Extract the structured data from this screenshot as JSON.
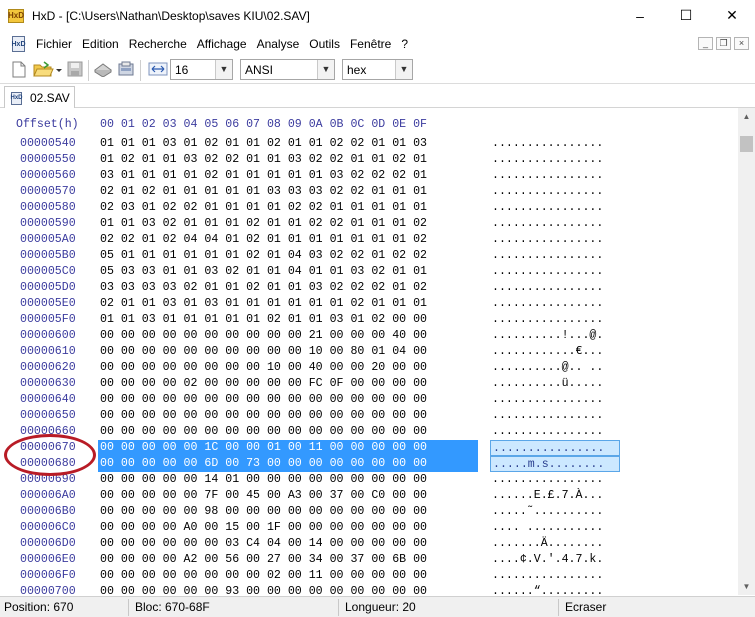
{
  "window": {
    "title": "HxD - [C:\\Users\\Nathan\\Desktop\\saves KIU\\02.SAV]",
    "icon": "hxd-app-icon",
    "minimize": "–",
    "maximize": "☐",
    "close": "✕"
  },
  "menu": {
    "items": [
      "Fichier",
      "Edition",
      "Recherche",
      "Affichage",
      "Analyse",
      "Outils",
      "Fenêtre",
      "?"
    ],
    "mdi_minimize": "_",
    "mdi_restore": "❐",
    "mdi_close": "×"
  },
  "toolbar": {
    "bytes_per_row": "16",
    "charset": "ANSI",
    "offset_base": "hex",
    "icons": [
      "new-file-icon",
      "open-folder-icon",
      "save-icon",
      "open-disk-icon",
      "open-ram-icon",
      "bytes-per-row-icon"
    ]
  },
  "tabs": [
    {
      "label": "02.SAV"
    }
  ],
  "editor": {
    "offset_header": "Offset(h)",
    "column_header": "00 01 02 03 04 05 06 07 08 09 0A 0B 0C 0D 0E 0F",
    "rows": [
      {
        "offset": "00000540",
        "hex": "01 01 01 03 01 02 01 01 02 01 01 02 02 01 01 03",
        "text": "................"
      },
      {
        "offset": "00000550",
        "hex": "01 02 01 01 03 02 02 01 01 03 02 02 01 01 02 01",
        "text": "................"
      },
      {
        "offset": "00000560",
        "hex": "03 01 01 01 01 02 01 01 01 01 01 03 02 02 02 01",
        "text": "................"
      },
      {
        "offset": "00000570",
        "hex": "02 01 02 01 01 01 01 01 03 03 03 02 02 01 01 01",
        "text": "................"
      },
      {
        "offset": "00000580",
        "hex": "02 03 01 02 02 01 01 01 01 02 02 01 01 01 01 01",
        "text": "................"
      },
      {
        "offset": "00000590",
        "hex": "01 01 03 02 01 01 01 02 01 01 02 02 01 01 01 02",
        "text": "................"
      },
      {
        "offset": "000005A0",
        "hex": "02 02 01 02 04 04 01 02 01 01 01 01 01 01 01 02",
        "text": "................"
      },
      {
        "offset": "000005B0",
        "hex": "05 01 01 01 01 01 01 02 01 04 03 02 02 01 02 02",
        "text": "................"
      },
      {
        "offset": "000005C0",
        "hex": "05 03 03 01 01 03 02 01 01 04 01 01 03 02 01 01",
        "text": "................"
      },
      {
        "offset": "000005D0",
        "hex": "03 03 03 03 02 01 01 02 01 01 03 02 02 02 01 02",
        "text": "................"
      },
      {
        "offset": "000005E0",
        "hex": "02 01 01 03 01 03 01 01 01 01 01 01 02 01 01 01",
        "text": "................"
      },
      {
        "offset": "000005F0",
        "hex": "01 01 03 01 01 01 01 01 02 01 01 03 01 02 00 00",
        "text": "................"
      },
      {
        "offset": "00000600",
        "hex": "00 00 00 00 00 00 00 00 00 00 21 00 00 00 40 00",
        "text": "..........!...@."
      },
      {
        "offset": "00000610",
        "hex": "00 00 00 00 00 00 00 00 00 00 10 00 80 01 04 00",
        "text": "............€..."
      },
      {
        "offset": "00000620",
        "hex": "00 00 00 00 00 00 00 00 10 00 40 00 00 20 00 00",
        "text": "..........@.. .."
      },
      {
        "offset": "00000630",
        "hex": "00 00 00 00 02 00 00 00 00 00 FC 0F 00 00 00 00",
        "text": "..........ü....."
      },
      {
        "offset": "00000640",
        "hex": "00 00 00 00 00 00 00 00 00 00 00 00 00 00 00 00",
        "text": "................"
      },
      {
        "offset": "00000650",
        "hex": "00 00 00 00 00 00 00 00 00 00 00 00 00 00 00 00",
        "text": "................"
      },
      {
        "offset": "00000660",
        "hex": "00 00 00 00 00 00 00 00 00 00 00 00 00 00 00 00",
        "text": "................"
      },
      {
        "offset": "00000670",
        "hex": "00 00 00 00 00 1C 00 00 01 00 11 00 00 00 00 00",
        "text": "................",
        "selected": true
      },
      {
        "offset": "00000680",
        "hex": "00 00 00 00 00 6D 00 73 00 00 00 00 00 00 00 00",
        "text": ".....m.s........",
        "selected": true
      },
      {
        "offset": "00000690",
        "hex": "00 00 00 00 00 14 01 00 00 00 00 00 00 00 00 00",
        "text": "................"
      },
      {
        "offset": "000006A0",
        "hex": "00 00 00 00 00 7F 00 45 00 A3 00 37 00 C0 00 00",
        "text": "......E.£.7.À..."
      },
      {
        "offset": "000006B0",
        "hex": "00 00 00 00 00 98 00 00 00 00 00 00 00 00 00 00",
        "text": ".....˜.........."
      },
      {
        "offset": "000006C0",
        "hex": "00 00 00 00 A0 00 15 00 1F 00 00 00 00 00 00 00",
        "text": ".... ..........."
      },
      {
        "offset": "000006D0",
        "hex": "00 00 00 00 00 00 03 C4 04 00 14 00 00 00 00 00",
        "text": ".......Ä........"
      },
      {
        "offset": "000006E0",
        "hex": "00 00 00 00 A2 00 56 00 27 00 34 00 37 00 6B 00",
        "text": "....¢.V.'.4.7.k."
      },
      {
        "offset": "000006F0",
        "hex": "00 00 00 00 00 00 00 00 02 00 11 00 00 00 00 00",
        "text": "................"
      },
      {
        "offset": "00000700",
        "hex": "00 00 00 00 00 00 93 00 00 00 00 00 00 00 00 00",
        "text": "......“........."
      }
    ]
  },
  "statusbar": {
    "position": "Position: 670",
    "block": "Bloc: 670-68F",
    "length": "Longueur: 20",
    "mode": "Ecraser"
  },
  "colors": {
    "selection_hex_bg": "#3399ff",
    "selection_text_bg": "#cce8ff",
    "offset_text": "#3b3b9e",
    "annotation_ring": "#b81c26"
  }
}
